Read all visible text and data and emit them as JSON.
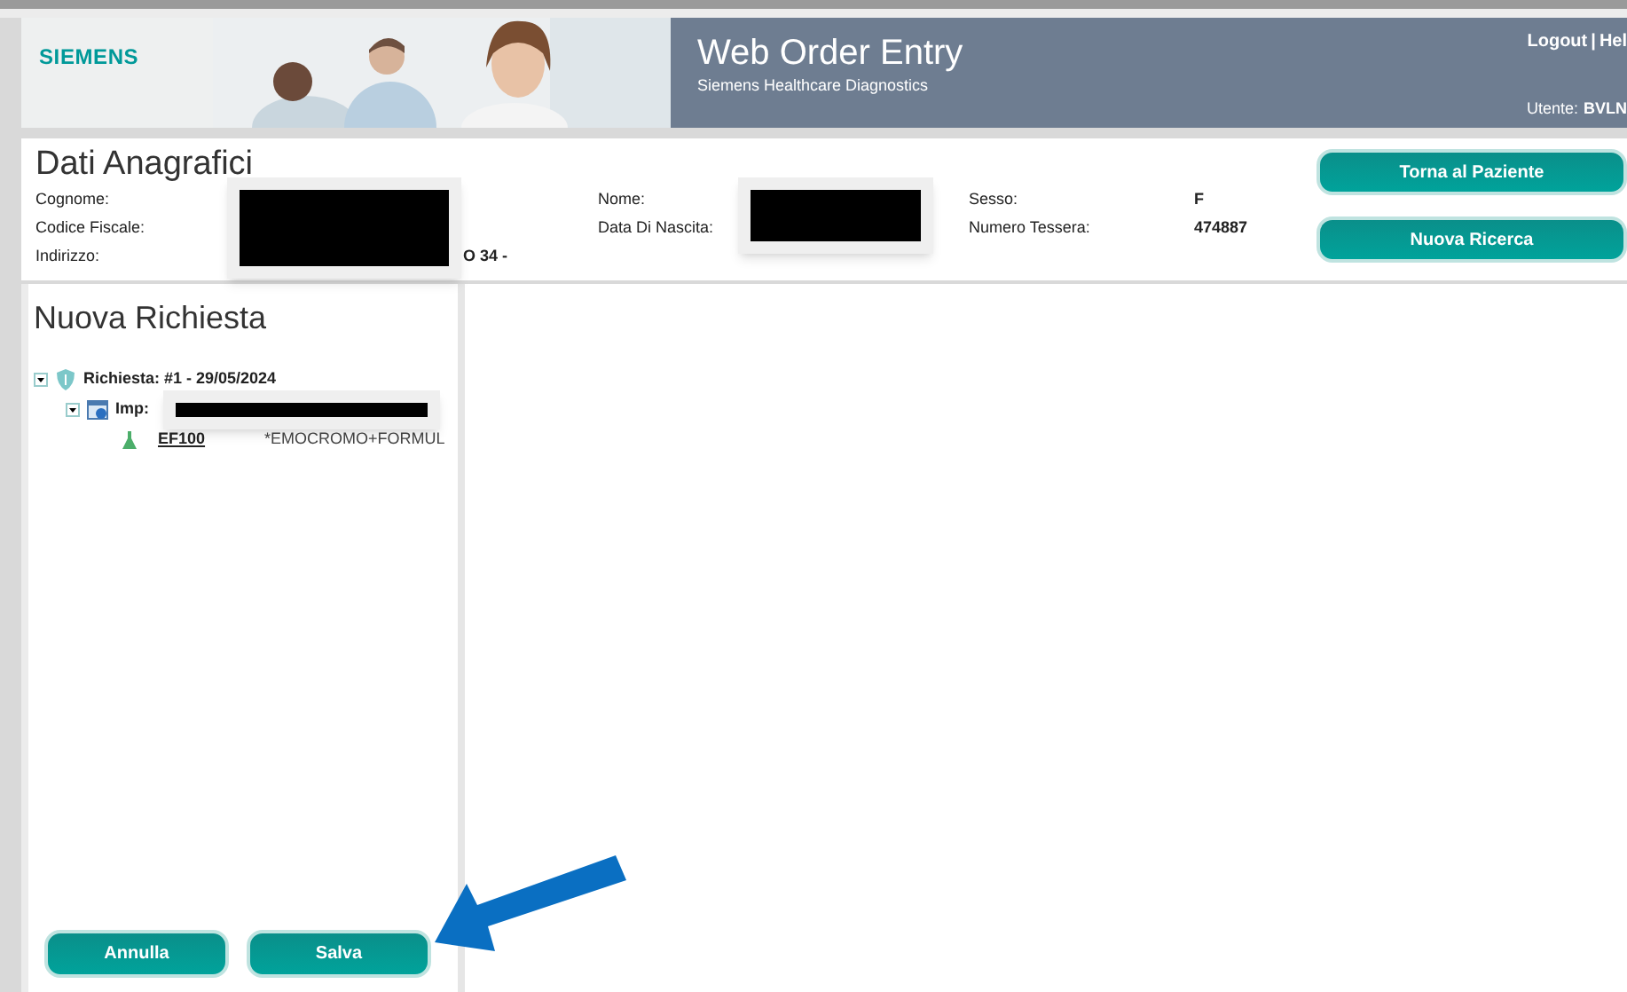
{
  "header": {
    "logo": "SIEMENS",
    "title": "Web Order Entry",
    "subtitle": "Siemens Healthcare Diagnostics",
    "links": [
      "Logout",
      "|",
      "Hel"
    ],
    "user_label": "Utente:",
    "user": "BVLN"
  },
  "patient": {
    "title": "Dati Anagrafici",
    "columns": [
      [
        {
          "label": "Cognome:"
        },
        {
          "label": "Codice Fiscale:"
        },
        {
          "label": "Indirizzo:",
          "value": "O 34 -"
        }
      ],
      [
        {
          "label": "Nome:"
        },
        {
          "label": "Data Di Nascita:"
        }
      ],
      [
        {
          "label": "Sesso:",
          "value": "F"
        },
        {
          "label": "Numero Tessera:",
          "value": "474887"
        }
      ]
    ],
    "buttons": [
      "Torna al Paziente",
      "Nuova Ricerca"
    ]
  },
  "request": {
    "title": "Nuova Richiesta",
    "tree": [
      {
        "kind": "request",
        "label": "Richiesta: #1 - 29/05/2024",
        "expanded": true,
        "children": [
          {
            "kind": "order",
            "label": "Imp:",
            "expanded": true,
            "children": [
              {
                "kind": "test",
                "code": "EF100",
                "description": "*EMOCROMO+FORMUL"
              }
            ]
          }
        ]
      }
    ],
    "buttons": [
      "Annulla",
      "Salva"
    ]
  }
}
